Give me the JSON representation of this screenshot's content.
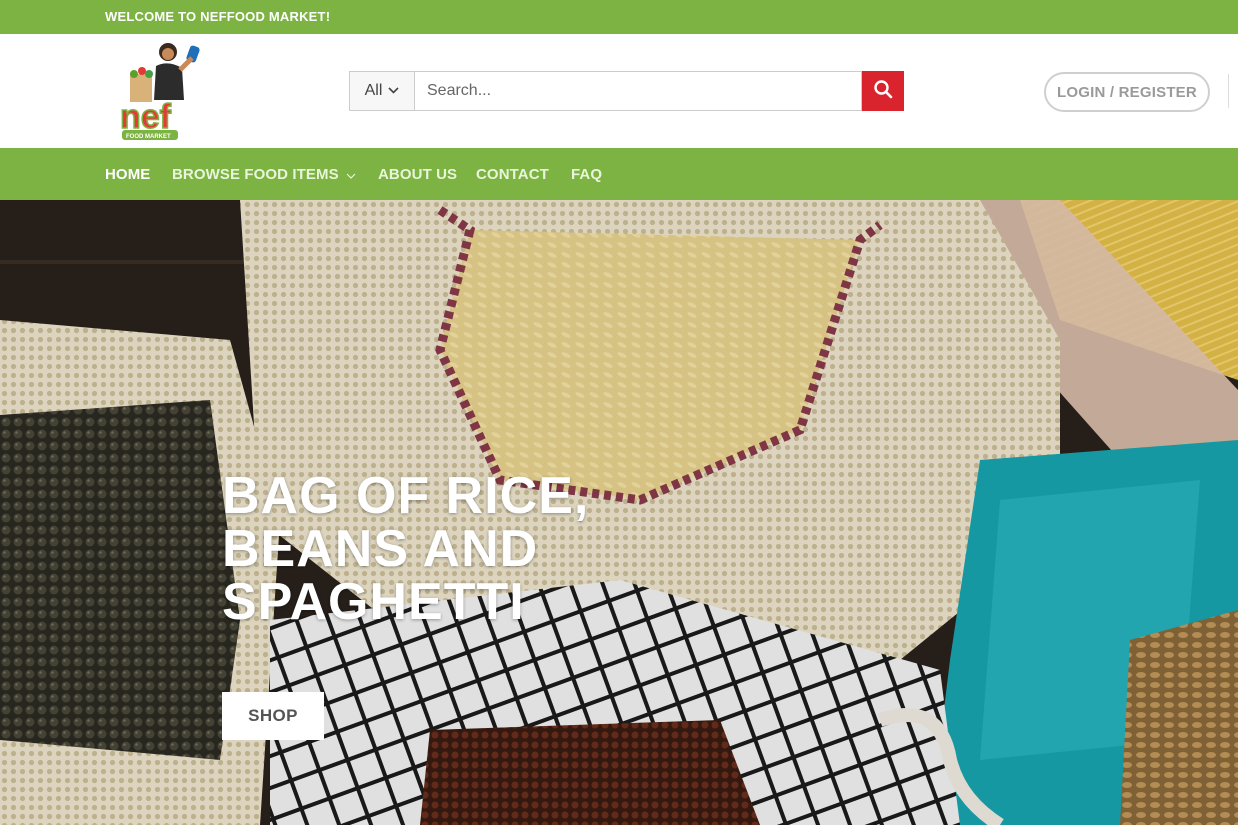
{
  "topbar": {
    "welcome_text": "WELCOME TO NEFFOOD MARKET!"
  },
  "header": {
    "logo": {
      "text": "nef",
      "subtext": "FOOD MARKET"
    },
    "search": {
      "category": "All",
      "placeholder": "Search...",
      "button_icon": "search-icon"
    },
    "login_label": "LOGIN / REGISTER"
  },
  "nav": {
    "items": [
      {
        "label": "HOME"
      },
      {
        "label": "BROWSE FOOD ITEMS"
      },
      {
        "label": "ABOUT US"
      },
      {
        "label": "CONTACT"
      },
      {
        "label": "FAQ"
      }
    ]
  },
  "hero": {
    "title": "BAG OF RICE,\nBEANS AND\nSPAGHETTI",
    "button_label": "SHOP"
  },
  "colors": {
    "brand_green": "#7cb342",
    "search_red": "#d9232d",
    "white": "#ffffff"
  }
}
